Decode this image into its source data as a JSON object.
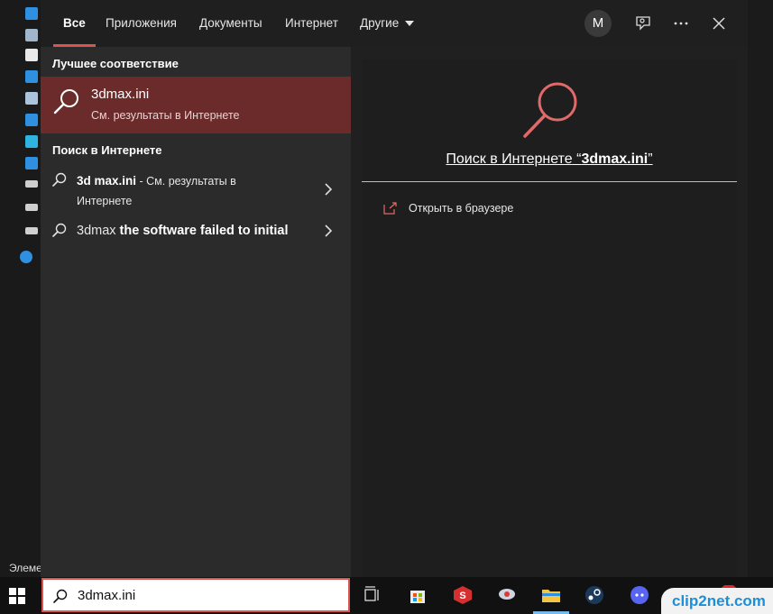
{
  "tabs": [
    "Все",
    "Приложения",
    "Документы",
    "Интернет",
    "Другие"
  ],
  "avatar_letter": "M",
  "best_match": {
    "section_title": "Лучшее соответствие",
    "title": "3dmax.ini",
    "subtitle": "См. результаты в Интернете"
  },
  "web": {
    "section_title": "Поиск в Интернете",
    "rows": [
      {
        "bold": "3d max.ini",
        "rest": " - См. результаты в",
        "line2": "Интернете"
      },
      {
        "bold_prefix": "3dmax",
        "bold": " the software failed to initial"
      }
    ]
  },
  "preview": {
    "link_prefix": "Поиск в Интернете “",
    "link_query": "3dmax.ini",
    "link_suffix": "”",
    "open_in_browser": "Открыть в браузере"
  },
  "background": {
    "status_text": "Элеме"
  },
  "taskbar": {
    "search_value": "3dmax.ini"
  },
  "watermark": "clip2net.com",
  "colors": {
    "accent": "#d9534f",
    "selected_bg": "#6b2b2b",
    "icon": "#e06a6a"
  }
}
